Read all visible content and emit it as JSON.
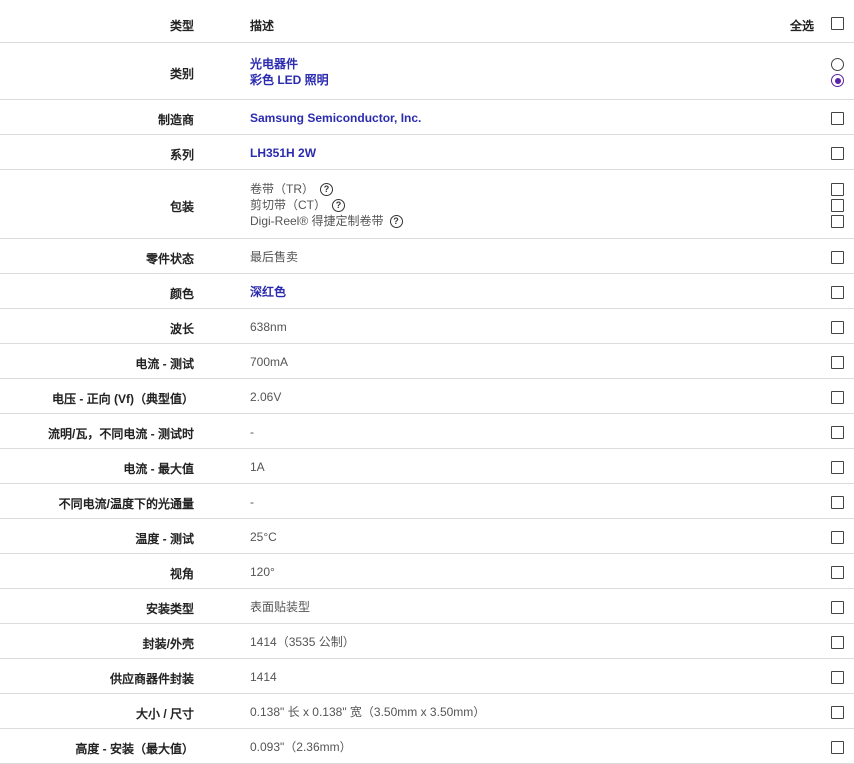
{
  "header": {
    "type_label": "类型",
    "desc_label": "描述",
    "select_all_label": "全选"
  },
  "rows": [
    {
      "label": "类别",
      "lines": [
        "光电器件",
        "彩色 LED 照明"
      ],
      "style": "link",
      "control": "radio",
      "selected": 1
    },
    {
      "label": "制造商",
      "lines": [
        "Samsung Semiconductor, Inc."
      ],
      "style": "link"
    },
    {
      "label": "系列",
      "lines": [
        "LH351H 2W"
      ],
      "style": "link"
    },
    {
      "label": "包装",
      "lines": [
        "卷带（TR）",
        "剪切带（CT）",
        "Digi-Reel® 得捷定制卷带"
      ],
      "style": "plain",
      "help": true,
      "multi": true
    },
    {
      "label": "零件状态",
      "lines": [
        "最后售卖"
      ],
      "style": "plain"
    },
    {
      "label": "颜色",
      "lines": [
        "深红色"
      ],
      "style": "link"
    },
    {
      "label": "波长",
      "lines": [
        "638nm"
      ],
      "style": "plain"
    },
    {
      "label": "电流 - 测试",
      "lines": [
        "700mA"
      ],
      "style": "plain"
    },
    {
      "label": "电压 - 正向 (Vf)（典型值）",
      "lines": [
        "2.06V"
      ],
      "style": "plain"
    },
    {
      "label": "流明/瓦，不同电流 - 测试时",
      "lines": [
        "-"
      ],
      "style": "plain"
    },
    {
      "label": "电流 - 最大值",
      "lines": [
        "1A"
      ],
      "style": "plain"
    },
    {
      "label": "不同电流/温度下的光通量",
      "lines": [
        "-"
      ],
      "style": "plain"
    },
    {
      "label": "温度 - 测试",
      "lines": [
        "25°C"
      ],
      "style": "plain"
    },
    {
      "label": "视角",
      "lines": [
        "120°"
      ],
      "style": "plain"
    },
    {
      "label": "安装类型",
      "lines": [
        "表面贴装型"
      ],
      "style": "plain"
    },
    {
      "label": "封装/外壳",
      "lines": [
        "1414（3535 公制）"
      ],
      "style": "plain"
    },
    {
      "label": "供应商器件封装",
      "lines": [
        "1414"
      ],
      "style": "plain"
    },
    {
      "label": "大小 / 尺寸",
      "lines": [
        "0.138\" 长 x 0.138\" 宽（3.50mm x 3.50mm）"
      ],
      "style": "plain"
    },
    {
      "label": "高度 - 安装（最大值）",
      "lines": [
        "0.093\"（2.36mm）"
      ],
      "style": "plain"
    }
  ]
}
